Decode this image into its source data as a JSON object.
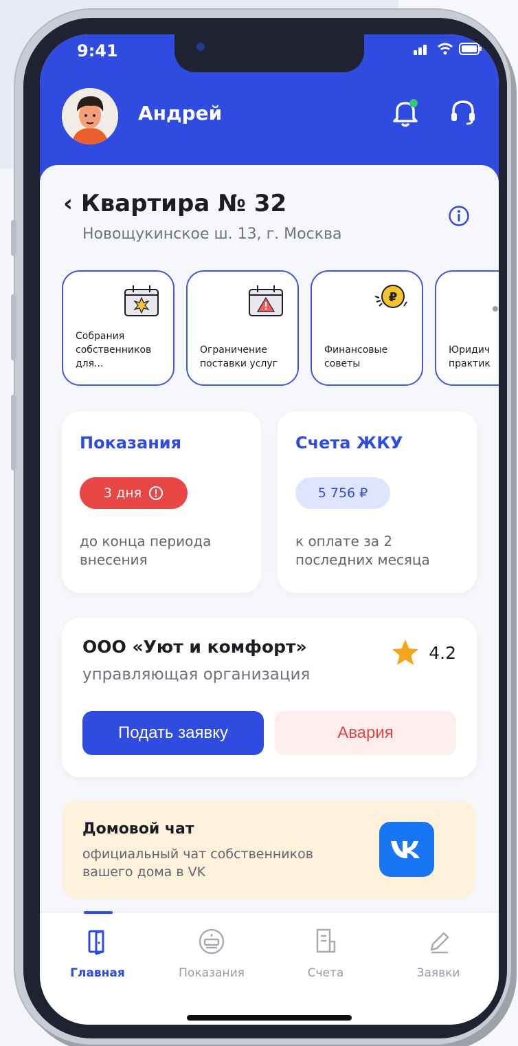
{
  "status": {
    "time": "9:41"
  },
  "user": {
    "name": "Андрей"
  },
  "apartment": {
    "title": "Квартира № 32",
    "address": "Новощукинское ш. 13, г. Москва"
  },
  "services": [
    {
      "label": "Собрания\nсобственников\nдля...",
      "icon": "calendar-burst-icon"
    },
    {
      "label": "Ограничение\nпоставки услуг",
      "icon": "calendar-warning-icon"
    },
    {
      "label": "Финансовые\nсоветы",
      "icon": "ruble-coin-icon"
    },
    {
      "label": "Юридич\nпрактик",
      "icon": "law-icon"
    }
  ],
  "readings": {
    "title": "Показания",
    "badge": "3 дня",
    "subtitle": "до конца периода\nвнесения"
  },
  "bills": {
    "title": "Счета ЖКУ",
    "badge": "5 756 ₽",
    "subtitle": "к оплате за 2\nпоследних месяца"
  },
  "org": {
    "name": "ООО «Уют и комфорт»",
    "subtitle": "управляющая организация",
    "rating": "4.2",
    "primary_button": "Подать заявку",
    "emergency_button": "Авария"
  },
  "chat": {
    "title": "Домовой чат",
    "subtitle": "официальный чат собственников\nвашего дома  в VK"
  },
  "tabs": [
    {
      "label": "Главная",
      "icon": "door-icon",
      "active": true
    },
    {
      "label": "Показания",
      "icon": "meter-icon",
      "active": false
    },
    {
      "label": "Счета",
      "icon": "receipt-icon",
      "active": false
    },
    {
      "label": "Заявки",
      "icon": "pencil-icon",
      "active": false
    }
  ],
  "colors": {
    "accent": "#2f4be0",
    "danger": "#e94646",
    "chat_bg": "#fdf1dc",
    "vk": "#1976f2"
  }
}
